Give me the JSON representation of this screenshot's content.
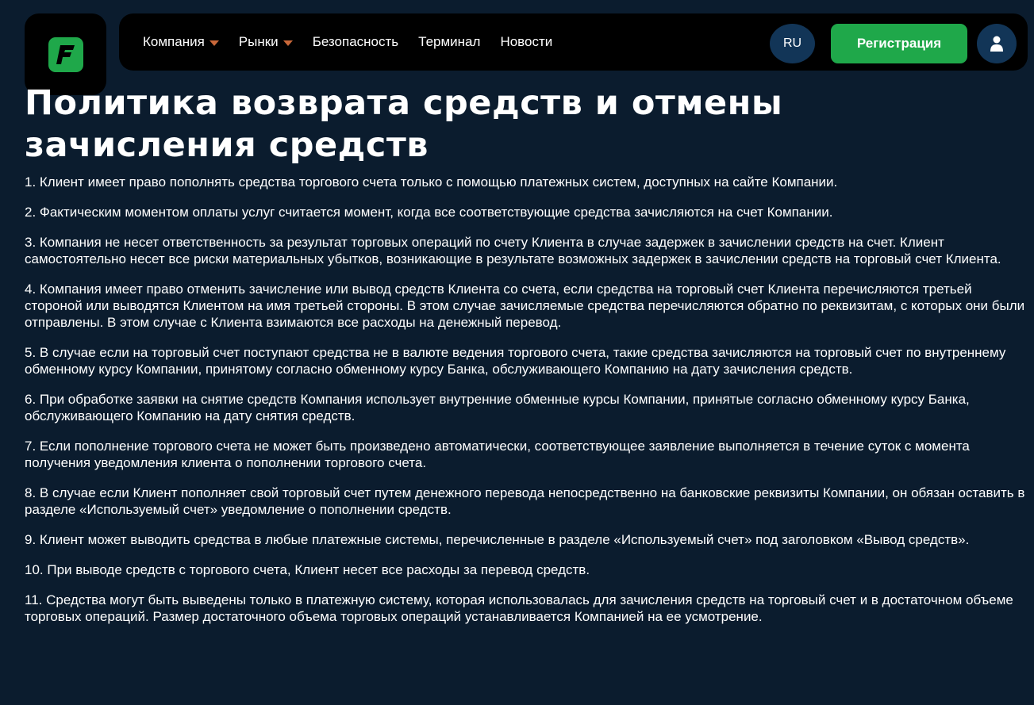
{
  "header": {
    "logo_icon": "f-logo-icon",
    "nav": [
      {
        "label": "Компания",
        "dropdown": true
      },
      {
        "label": "Рынки",
        "dropdown": true
      },
      {
        "label": "Безопасность",
        "dropdown": false
      },
      {
        "label": "Терминал",
        "dropdown": false
      },
      {
        "label": "Новости",
        "dropdown": false
      }
    ],
    "lang_label": "RU",
    "register_label": "Регистрация",
    "avatar_icon": "user-icon"
  },
  "page": {
    "title": "Политика возврата средств и отмены зачисления средств",
    "paragraphs": [
      "1. Клиент имеет право пополнять средства торгового счета только с помощью платежных систем, доступных на сайте Компании.",
      "2. Фактическим моментом оплаты услуг считается момент, когда все соответствующие средства зачисляются на счет Компании.",
      "3. Компания не несет ответственность за результат торговых операций по счету Клиента в случае задержек в зачислении средств на счет. Клиент самостоятельно несет все риски материальных убытков, возникающие в результате возможных задержек в зачислении средств на торговый счет Клиента.",
      "4. Компания имеет право отменить зачисление или вывод средств Клиента со счета, если средства на торговый счет Клиента перечисляются третьей стороной или выводятся Клиентом на имя третьей стороны. В этом случае зачисляемые средства перечисляются обратно по реквизитам, с которых они были отправлены. В этом случае с Клиента взимаются все расходы на денежный перевод.",
      "5. В случае если на торговый счет поступают средства не в валюте ведения торгового счета, такие средства зачисляются на торговый счет по внутреннему обменному курсу Компании, принятому согласно обменному курсу Банка, обслуживающего Компанию на дату зачисления средств.",
      "6. При обработке заявки на снятие средств Компания использует внутренние обменные курсы Компании, принятые согласно обменному курсу Банка, обслуживающего Компанию на дату снятия средств.",
      "7. Если пополнение торгового счета не может быть произведено автоматически, соответствующее заявление выполняется в течение суток с момента получения уведомления клиента о пополнении торгового счета.",
      "8. В случае если Клиент пополняет свой торговый счет путем денежного перевода непосредственно на банковские реквизиты Компании, он обязан оставить в разделе «Используемый счет» уведомление о пополнении средств.",
      "9. Клиент может выводить средства в любые платежные системы, перечисленные в разделе «Используемый счет» под заголовком «Вывод средств».",
      "10. При выводе средств с торгового счета, Клиент несет все расходы за перевод средств.",
      "11. Средства могут быть выведены только в платежную систему, которая использовалась для зачисления средств на торговый счет и в достаточном объеме торговых операций. Размер достаточного объема торговых операций устанавливается Компанией на ее усмотрение."
    ]
  },
  "colors": {
    "background": "#0b1c2e",
    "header_bg": "#000000",
    "accent_green": "#1fa84a",
    "circle_button": "#123557",
    "caret": "#c9683a"
  }
}
